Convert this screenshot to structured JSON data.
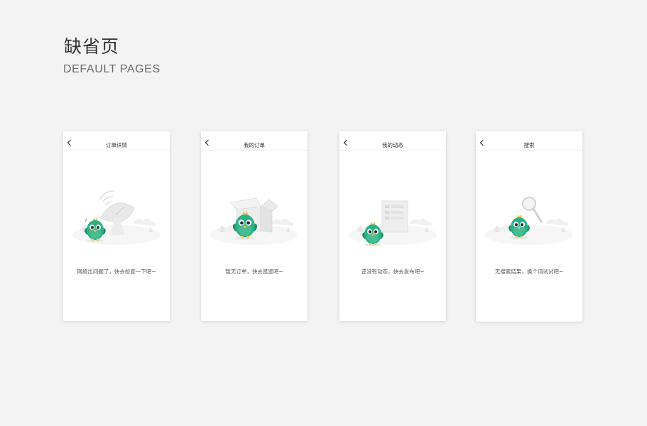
{
  "header": {
    "title": "缺省页",
    "subtitle": "DEFAULT PAGES"
  },
  "screens": [
    {
      "nav_title": "订单详情",
      "message": "网络出问题了，快去检查一下吧~"
    },
    {
      "nav_title": "我的订单",
      "message": "暂无订单，快去逛逛吧~"
    },
    {
      "nav_title": "我的动态",
      "message": "还没有动态，快去发布吧~"
    },
    {
      "nav_title": "搜索",
      "message": "无搜索结果，换个词试试吧~"
    }
  ],
  "icons": {
    "back": "chevron-left-icon",
    "mascot": "green-bird-mascot-icon",
    "network": "satellite-dish-icon",
    "orders": "open-box-icon",
    "feed": "document-icon",
    "search": "magnifier-icon"
  },
  "colors": {
    "background": "#f3f3f3",
    "card": "#ffffff",
    "mascot_green": "#2bb085",
    "mascot_dark": "#1f8d6a",
    "accent_yellow": "#f2c94c"
  }
}
